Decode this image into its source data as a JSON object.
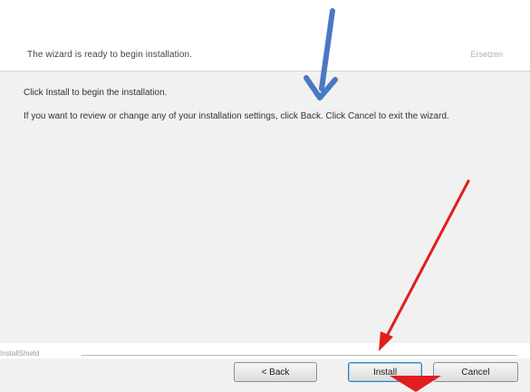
{
  "header": {
    "subtitle": "The wizard is ready to begin installation.",
    "logo_text": "Ersetzen"
  },
  "body": {
    "line1": "Click Install to begin the installation.",
    "line2": "If you want to review or change any of your installation settings, click Back. Click Cancel to exit the wizard."
  },
  "brand": {
    "label": "InstallShield"
  },
  "buttons": {
    "back": "< Back",
    "install": "Install",
    "cancel": "Cancel"
  },
  "annotations": {
    "blue_arrow_color": "#4a78c2",
    "red_arrow_color": "#e21d1d"
  }
}
